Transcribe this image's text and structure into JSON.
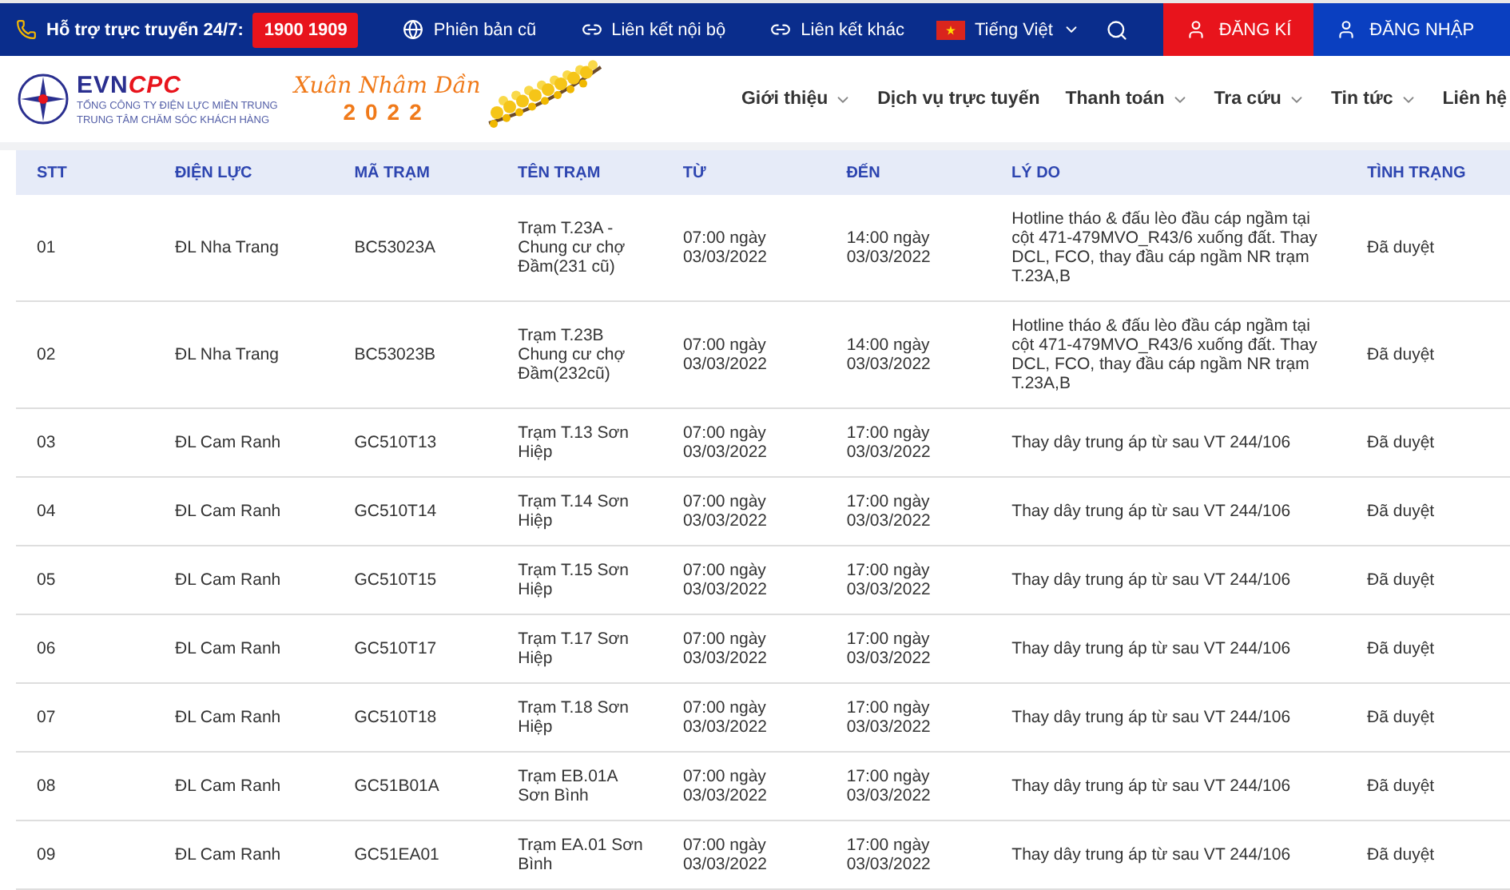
{
  "topbar": {
    "hotline_label": "Hỗ trợ trực truyến 24/7:",
    "hotline_number": "1900 1909",
    "links": [
      {
        "kind": "globe",
        "label": "Phiên bản cũ"
      },
      {
        "kind": "link",
        "label": "Liên kết nội bộ"
      },
      {
        "kind": "link",
        "label": "Liên kết khác"
      }
    ],
    "language": "Tiếng Việt",
    "register": "ĐĂNG KÍ",
    "login": "ĐĂNG NHẬP"
  },
  "logo": {
    "brand_a": "EVN",
    "brand_b": "CPC",
    "line_1": "TỔNG CÔNG TY ĐIỆN LỰC MIỀN TRUNG",
    "line_2": "TRUNG TÂM CHĂM SÓC KHÁCH HÀNG",
    "greeting": "Xuân Nhâm Dần",
    "year": "2022"
  },
  "nav": [
    {
      "label": "Giới thiệu",
      "dropdown": true
    },
    {
      "label": "Dịch vụ trực tuyến",
      "dropdown": false
    },
    {
      "label": "Thanh toán",
      "dropdown": true
    },
    {
      "label": "Tra cứu",
      "dropdown": true
    },
    {
      "label": "Tin tức",
      "dropdown": true
    },
    {
      "label": "Liên hệ",
      "dropdown": false
    }
  ],
  "table": {
    "columns": [
      "STT",
      "ĐIỆN LỰC",
      "MÃ TRẠM",
      "TÊN TRẠM",
      "TỪ",
      "ĐẾN",
      "LÝ DO",
      "TÌNH TRẠNG"
    ],
    "rows": [
      [
        "01",
        "ĐL Nha Trang",
        "BC53023A",
        "Trạm T.23A - Chung cư chợ Đầm(231 cũ)",
        "07:00 ngày 03/03/2022",
        "14:00 ngày 03/03/2022",
        "Hotline tháo & đấu lèo đầu cáp ngầm tại cột 471-479MVO_R43/6 xuống đất. Thay DCL, FCO, thay đầu cáp ngầm NR trạm T.23A,B",
        "Đã duyệt"
      ],
      [
        "02",
        "ĐL Nha Trang",
        "BC53023B",
        "Trạm T.23B Chung cư chợ Đầm(232cũ)",
        "07:00 ngày 03/03/2022",
        "14:00 ngày 03/03/2022",
        "Hotline tháo & đấu lèo đầu cáp ngầm tại cột 471-479MVO_R43/6 xuống đất. Thay DCL, FCO, thay đầu cáp ngầm NR trạm T.23A,B",
        "Đã duyệt"
      ],
      [
        "03",
        "ĐL Cam Ranh",
        "GC510T13",
        "Trạm T.13 Sơn Hiệp",
        "07:00 ngày 03/03/2022",
        "17:00 ngày 03/03/2022",
        "Thay dây trung áp từ sau VT 244/106",
        "Đã duyệt"
      ],
      [
        "04",
        "ĐL Cam Ranh",
        "GC510T14",
        "Trạm T.14 Sơn Hiệp",
        "07:00 ngày 03/03/2022",
        "17:00 ngày 03/03/2022",
        "Thay dây trung áp từ sau VT 244/106",
        "Đã duyệt"
      ],
      [
        "05",
        "ĐL Cam Ranh",
        "GC510T15",
        "Trạm T.15 Sơn Hiệp",
        "07:00 ngày 03/03/2022",
        "17:00 ngày 03/03/2022",
        "Thay dây trung áp từ sau VT 244/106",
        "Đã duyệt"
      ],
      [
        "06",
        "ĐL Cam Ranh",
        "GC510T17",
        "Trạm T.17 Sơn Hiệp",
        "07:00 ngày 03/03/2022",
        "17:00 ngày 03/03/2022",
        "Thay dây trung áp từ sau VT 244/106",
        "Đã duyệt"
      ],
      [
        "07",
        "ĐL Cam Ranh",
        "GC510T18",
        "Trạm T.18 Sơn Hiệp",
        "07:00 ngày 03/03/2022",
        "17:00 ngày 03/03/2022",
        "Thay dây trung áp từ sau VT 244/106",
        "Đã duyệt"
      ],
      [
        "08",
        "ĐL Cam Ranh",
        "GC51B01A",
        "Trạm EB.01A Sơn Bình",
        "07:00 ngày 03/03/2022",
        "17:00 ngày 03/03/2022",
        "Thay dây trung áp từ sau VT 244/106",
        "Đã duyệt"
      ],
      [
        "09",
        "ĐL Cam Ranh",
        "GC51EA01",
        "Trạm EA.01 Sơn Bình",
        "07:00 ngày 03/03/2022",
        "17:00 ngày 03/03/2022",
        "Thay dây trung áp từ sau VT 244/106",
        "Đã duyệt"
      ]
    ]
  }
}
